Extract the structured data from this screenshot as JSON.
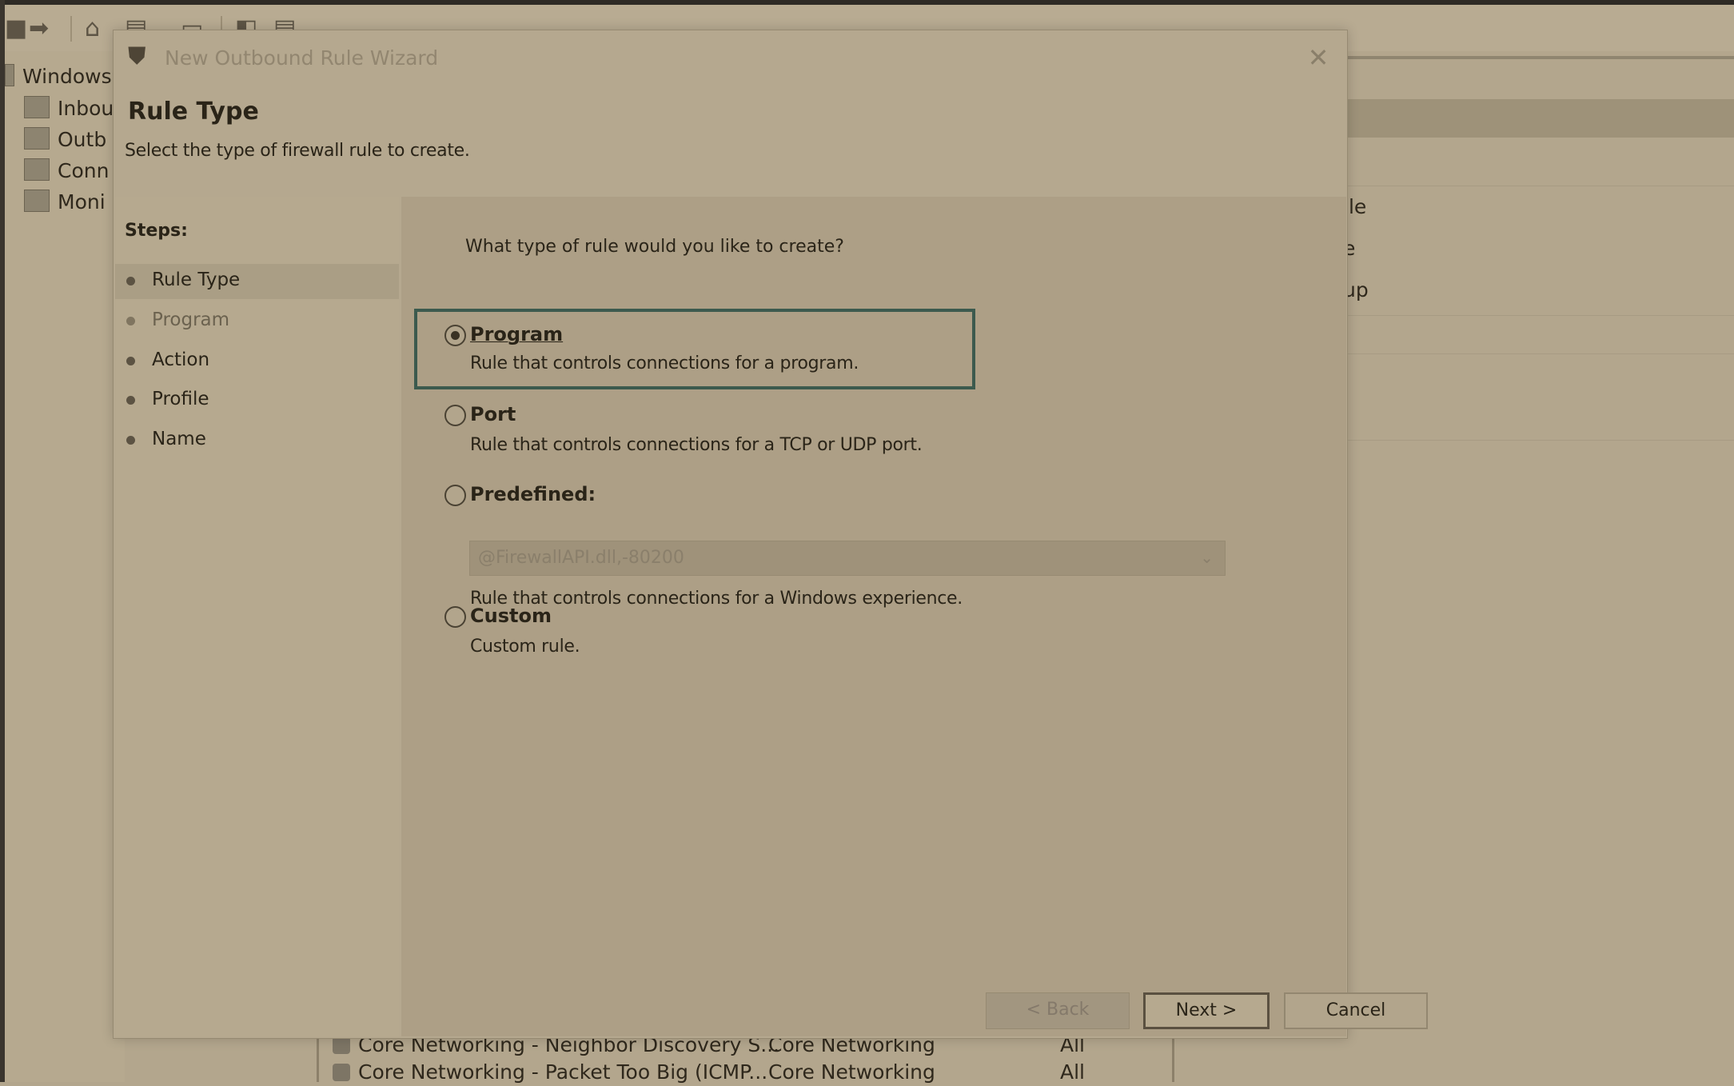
{
  "background": {
    "tree_items": [
      "Windows",
      "Inbou",
      "Outb",
      "Conn",
      "Moni"
    ],
    "right_pane_items": [
      "ile",
      "e",
      "up"
    ],
    "bottom_rows": [
      {
        "name": "Core Networking - Neighbor Discovery S...",
        "group": "Core Networking",
        "profile": "All"
      },
      {
        "name": "Core Networking - Packet Too Big (ICMP...",
        "group": "Core Networking",
        "profile": "All"
      }
    ]
  },
  "dialog": {
    "title": "New Outbound Rule Wizard",
    "header_title": "Rule Type",
    "header_subtitle": "Select the type of firewall rule to create.",
    "steps_label": "Steps:",
    "steps": [
      "Rule Type",
      "Program",
      "Action",
      "Profile",
      "Name"
    ],
    "question": "What type of rule would you like to create?",
    "options": [
      {
        "label": "Program",
        "description": "Rule that controls connections for a program.",
        "selected": true
      },
      {
        "label": "Port",
        "description": "Rule that controls connections for a TCP or UDP port.",
        "selected": false
      },
      {
        "label": "Predefined:",
        "description": "Rule that controls connections for a Windows experience.",
        "selected": false
      },
      {
        "label": "Custom",
        "description": "Custom rule.",
        "selected": false
      }
    ],
    "predefined_combo_value": "@FirewallAPI.dll,-80200",
    "buttons": {
      "back": "< Back",
      "next": "Next >",
      "cancel": "Cancel"
    }
  }
}
